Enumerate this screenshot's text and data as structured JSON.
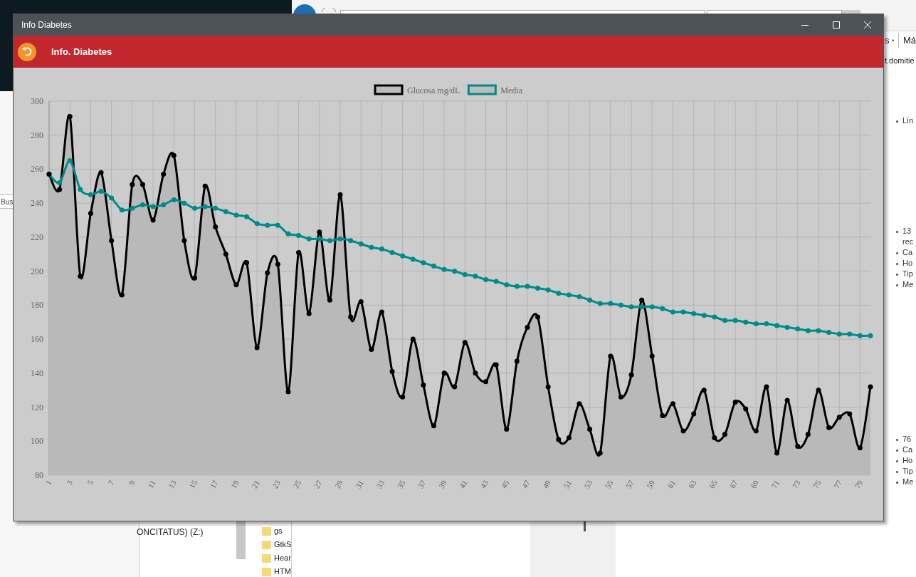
{
  "desktop": {
    "browser": {
      "menu_text": "s",
      "menu_text_2": "Má",
      "address_fragment": "t.domitie",
      "list_groups": [
        [
          "Lín"
        ],
        [
          "13",
          "rec",
          "Ca",
          "Ho",
          "Tip",
          "Me"
        ],
        [
          "76",
          "Ca",
          "Ho",
          "Tip",
          "Me"
        ]
      ]
    },
    "search_fragment": "Bus",
    "explorer": {
      "drive": "ONCITATUS) (Z:)",
      "folders": [
        "gs",
        "GtkS",
        "Hear",
        "HTM"
      ]
    }
  },
  "window": {
    "title": "Info Diabetes",
    "header": "Info. Diabetes",
    "chart_data": {
      "type": "area",
      "grid": true,
      "legend": true,
      "x": [
        1,
        2,
        3,
        4,
        5,
        6,
        7,
        8,
        9,
        10,
        11,
        12,
        13,
        14,
        15,
        16,
        17,
        18,
        19,
        20,
        21,
        22,
        23,
        24,
        25,
        26,
        27,
        28,
        29,
        30,
        31,
        32,
        33,
        34,
        35,
        36,
        37,
        38,
        39,
        40,
        41,
        42,
        43,
        44,
        45,
        46,
        47,
        48,
        49,
        50,
        51,
        52,
        53,
        54,
        55,
        56,
        57,
        58,
        59,
        60,
        61,
        62,
        63,
        64,
        65,
        66,
        67,
        68,
        69,
        70,
        71,
        72,
        73,
        74,
        75,
        76,
        77,
        78,
        79,
        80
      ],
      "xlim": [
        1,
        80
      ],
      "xticks": [
        1,
        3,
        5,
        7,
        9,
        11,
        13,
        15,
        17,
        19,
        21,
        23,
        25,
        27,
        29,
        31,
        33,
        35,
        37,
        39,
        41,
        43,
        45,
        47,
        49,
        51,
        53,
        55,
        57,
        59,
        61,
        63,
        65,
        67,
        69,
        71,
        73,
        75,
        77,
        79
      ],
      "ylim": [
        80,
        300
      ],
      "yticks": [
        80,
        100,
        120,
        140,
        160,
        180,
        200,
        220,
        240,
        260,
        280,
        300
      ],
      "series": [
        {
          "name": "Glucosa mg/dL",
          "color": "#000000",
          "marker": "circle",
          "values": [
            257,
            248,
            291,
            197,
            234,
            258,
            218,
            186,
            251,
            251,
            230,
            257,
            268,
            218,
            196,
            250,
            226,
            210,
            192,
            205,
            155,
            199,
            204,
            129,
            211,
            175,
            223,
            183,
            245,
            173,
            182,
            154,
            176,
            141,
            126,
            160,
            133,
            109,
            140,
            132,
            158,
            140,
            135,
            145,
            107,
            147,
            167,
            173,
            132,
            101,
            102,
            122,
            107,
            93,
            150,
            126,
            139,
            183,
            150,
            115,
            122,
            106,
            116,
            130,
            102,
            104,
            123,
            119,
            106,
            132,
            93,
            124,
            97,
            104,
            130,
            108,
            114,
            116,
            96,
            132
          ]
        },
        {
          "name": "Media",
          "color": "#008b8b",
          "type": "line",
          "marker": "circle",
          "values": [
            257,
            252,
            265,
            248,
            245,
            247,
            243,
            236,
            237,
            239,
            238,
            239,
            242,
            240,
            237,
            238,
            237,
            235,
            233,
            232,
            228,
            227,
            227,
            222,
            221,
            219,
            219,
            218,
            219,
            218,
            216,
            214,
            213,
            211,
            209,
            207,
            205,
            203,
            201,
            200,
            198,
            197,
            195,
            194,
            192,
            191,
            191,
            190,
            189,
            187,
            186,
            185,
            183,
            181,
            181,
            180,
            179,
            179,
            179,
            178,
            176,
            176,
            175,
            174,
            173,
            171,
            171,
            170,
            169,
            169,
            168,
            167,
            166,
            165,
            165,
            164,
            163,
            163,
            162,
            162
          ]
        }
      ]
    }
  }
}
